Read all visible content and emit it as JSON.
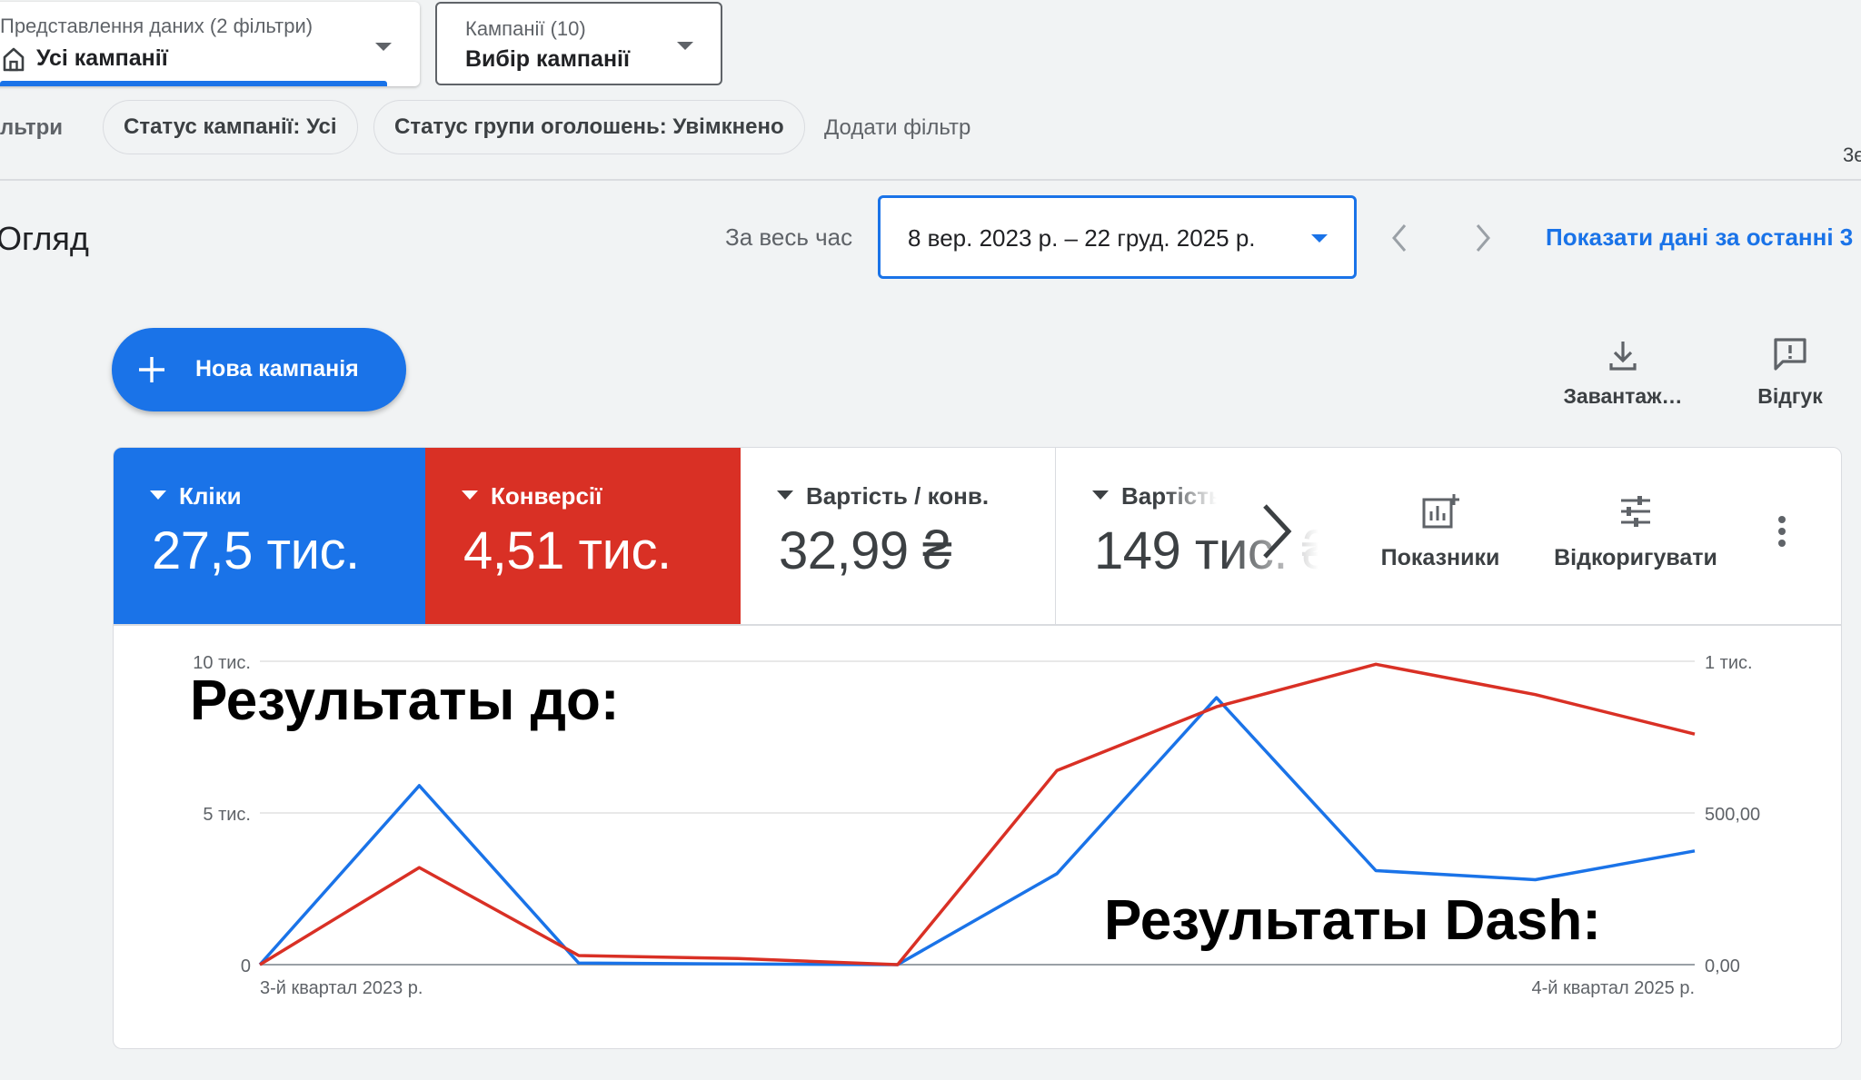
{
  "view_selector": {
    "caption": "Представлення даних (2 фільтри)",
    "value": "Усі кампанії",
    "icon": "home-icon"
  },
  "campaign_selector": {
    "caption": "Кампанії (10)",
    "value": "Вибір кампанії"
  },
  "filters": {
    "label": "льтри",
    "chips": [
      "Статус кампанії: Усі",
      "Статус групи оголошень: Увімкнено"
    ],
    "add_filter": "Додати фільтр",
    "edge_fragment": "3є"
  },
  "overview": {
    "title": "Огляд",
    "date_preset": "За весь час",
    "date_range": "8 вер. 2023 р. – 22 груд. 2025 р.",
    "show_recent_link": "Показати дані за останні 3"
  },
  "actions": {
    "new_campaign": "Нова кампанія",
    "download": "Завантаж…",
    "feedback": "Відгук"
  },
  "metrics": {
    "tiles": [
      {
        "label": "Кліки",
        "value": "27,5 тис.",
        "color": "#1a73e8"
      },
      {
        "label": "Конверсії",
        "value": "4,51 тис.",
        "color": "#d93025"
      },
      {
        "label": "Вартість / конв.",
        "value": "32,99 ₴"
      },
      {
        "label": "Вартість",
        "value": "149 тис. ₴"
      }
    ],
    "more_metrics": "Показники",
    "adjust": "Відкоригувати"
  },
  "chart_data": {
    "type": "line",
    "x_labels": [
      "3-й квартал 2023 р.",
      "4-й квартал 2025 р."
    ],
    "left_axis": {
      "ticks": [
        "10 тис.",
        "5 тис.",
        "0"
      ],
      "ylim": [
        0,
        10000
      ]
    },
    "right_axis": {
      "ticks": [
        "1 тис.",
        "500,00",
        "0,00"
      ],
      "ylim": [
        0,
        1000
      ]
    },
    "series": [
      {
        "color": "#1a73e8",
        "axis": "left",
        "values": [
          0,
          5900,
          50,
          20,
          0,
          3000,
          8800,
          3100,
          2800,
          3750
        ]
      },
      {
        "color": "#d93025",
        "axis": "right",
        "values": [
          0,
          320,
          30,
          20,
          0,
          640,
          850,
          990,
          890,
          760
        ]
      }
    ],
    "grid": true
  },
  "annotations": {
    "before": "Результаты до:",
    "after": "Результаты Dash:"
  }
}
